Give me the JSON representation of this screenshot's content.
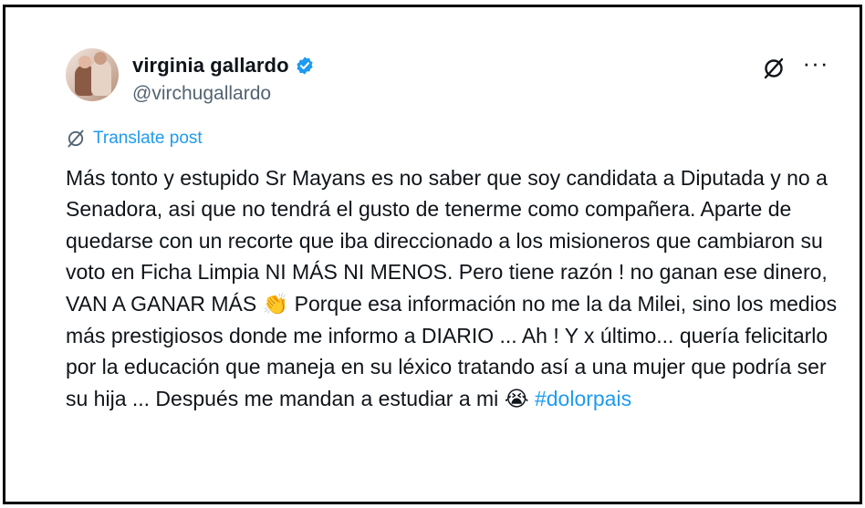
{
  "user": {
    "display_name": "virginia gallardo",
    "handle": "@virchugallardo",
    "verified": true
  },
  "actions": {
    "grok_icon": "grok-slash-icon",
    "more_icon": "more-options-icon",
    "more_glyph": "···"
  },
  "translate": {
    "label": "Translate post",
    "icon": "grok-slash-icon"
  },
  "post": {
    "text_part1": "Más tonto y estupido Sr Mayans es no saber que soy candidata a Diputada y no a Senadora, asi que no tendrá el gusto de tenerme como compañera. Aparte de quedarse con un recorte que iba direccionado a los misioneros que cambiaron su voto en Ficha Limpia NI MÁS NI MENOS. Pero tiene razón ! no ganan ese dinero, VAN A GANAR MÁS ",
    "emoji_clap": "👏",
    "text_part2": " Porque esa información no me la da Milei, sino los medios más prestigiosos donde me informo a DIARIO ... Ah ! Y x último... quería felicitarlo por la educación que maneja en su léxico tratando así a una mujer que podría ser su hija ... Después me mandan a estudiar a mi ",
    "emoji_cry": "😭",
    "text_part3": " ",
    "hashtag": "#dolorpais"
  },
  "colors": {
    "text": "#0f1419",
    "secondary": "#536471",
    "accent": "#1d9bf0"
  }
}
